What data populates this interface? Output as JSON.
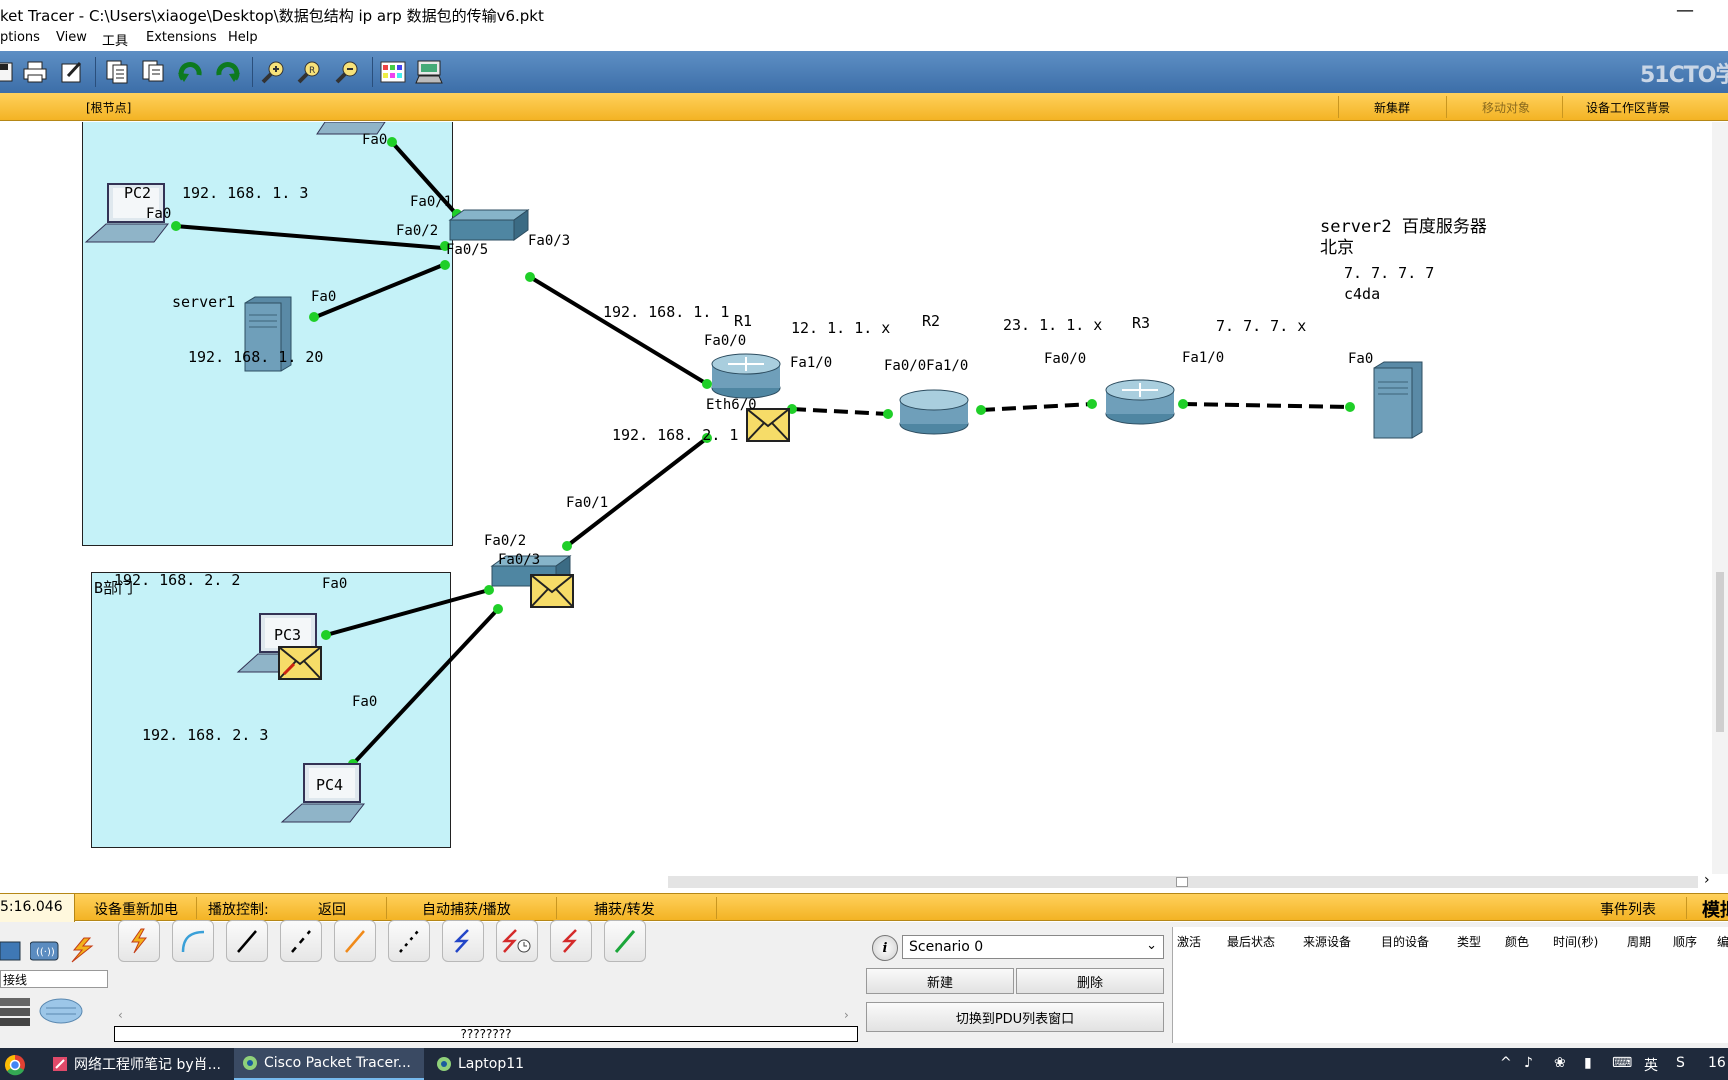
{
  "window": {
    "title": "ket Tracer - C:\\Users\\xiaoge\\Desktop\\数据包结构 ip arp 数据包的传输v6.pkt",
    "minimize": "—"
  },
  "menu": [
    "ptions",
    "View",
    "工具",
    "Extensions",
    "Help"
  ],
  "toolbar": {
    "buttons": [
      "save-icon",
      "print-icon",
      "activity-wizard-icon",
      "copy-icon",
      "paste-icon",
      "undo-icon",
      "redo-icon",
      "zoom-in-icon",
      "zoom-reset-icon",
      "zoom-out-icon",
      "palette-icon",
      "custom-device-icon"
    ],
    "watermark": "51CTO学"
  },
  "logicbar": {
    "root": "[根节点]",
    "new_cluster": "新集群",
    "move_object": "移动对象",
    "set_background": "设备工作区背景"
  },
  "topology": {
    "areaB_title": "B部门",
    "devices": {
      "pc2": "PC2",
      "server1": "server1",
      "pc3": "PC3",
      "pc4": "PC4",
      "r1": "R1",
      "r2": "R2",
      "r3": "R3"
    },
    "labels": {
      "pc2_ip": "192. 168. 1. 3",
      "server1_ip": "192. 168. 1. 20",
      "r1_fa00_ip": "192. 168. 1. 1",
      "r1_eth_ip": "192. 168. 2. 1",
      "net_r1r2": "12. 1. 1. x",
      "net_r2r3": "23. 1. 1. x",
      "net_r3srv": "7. 7. 7. x",
      "pc3_ip": "192. 168. 2. 2",
      "pc4_ip": "192. 168. 2. 3",
      "server2_note": "server2 百度服务器",
      "server2_city": "北京",
      "server2_ip": "7. 7. 7. 7",
      "server2_mac": "c4da"
    },
    "ports": {
      "fa0": "Fa0",
      "fa01": "Fa0/1",
      "fa02": "Fa0/2",
      "fa03": "Fa0/3",
      "fa05": "Fa0/5",
      "fa00": "Fa0/0",
      "fa10": "Fa1/0",
      "eth60": "Eth6/0",
      "r2_fa00fa10": "Fa0/0Fa1/0"
    }
  },
  "scroll": {
    "right_arrow": "›"
  },
  "simbar": {
    "time": "5:16.046",
    "power_cycle": "设备重新加电",
    "play_control": "播放控制:",
    "back": "返回",
    "auto_capture": "自动捕获/播放",
    "capture_forward": "捕获/转发",
    "event_list": "事件列表",
    "mode_partial": "模拟"
  },
  "bottom": {
    "device_type_partial": "接线",
    "connections": [
      "auto-connection-icon",
      "console-cable-icon",
      "straight-through-icon",
      "crossover-icon",
      "fiber-icon",
      "phone-cable-icon",
      "coaxial-icon",
      "serial-dce-icon",
      "serial-dte-icon",
      "octal-cable-icon"
    ],
    "conn_status": "????????",
    "scenario": "Scenario 0",
    "new_btn": "新建",
    "delete_btn": "删除",
    "toggle_pdu": "切换到PDU列表窗口",
    "event_columns": [
      "激活",
      "最后状态",
      "来源设备",
      "目的设备",
      "类型",
      "颜色",
      "时间(秒)",
      "周期",
      "顺序",
      "编"
    ]
  },
  "taskbar": {
    "tasks": [
      "网络工程师笔记 by肖...",
      "Cisco Packet Tracer...",
      "Laptop11"
    ],
    "tray_ime": "英",
    "clock": "16"
  },
  "colors": {
    "toolbar": "#4a7db8",
    "yellow_bar": "#f7bf38",
    "area_fill": "#c5f2f8",
    "link_up": "#1fcf28"
  }
}
